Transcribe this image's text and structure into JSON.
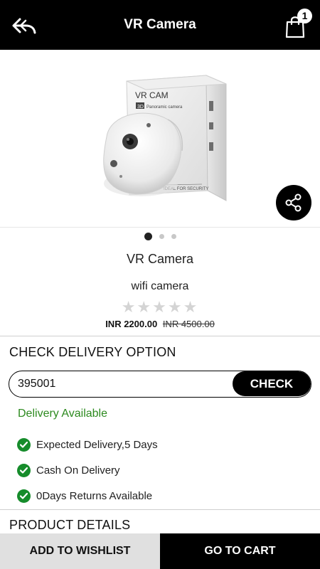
{
  "header": {
    "title": "VR Camera",
    "cart_count": "1",
    "icons": {
      "back": "back-arrow-icon",
      "cart": "shopping-bag-icon"
    }
  },
  "product_image": {
    "box_title": "VR CAM",
    "box_badge": "3D",
    "box_subtitle": "Panoramic camera",
    "box_footer": "IDEAL FOR SECURITY"
  },
  "carousel": {
    "total": 3,
    "active": 0
  },
  "product": {
    "name": "VR Camera",
    "subtitle": "wifi camera",
    "rating": 0,
    "rating_max": 5,
    "price": "INR 2200.00",
    "old_price": "INR 4500.00"
  },
  "delivery": {
    "title": "CHECK DELIVERY OPTION",
    "pincode": "395001",
    "check_label": "CHECK",
    "status": "Delivery Available",
    "features": [
      "Expected Delivery,5 Days",
      "Cash On Delivery",
      "0Days Returns Available"
    ]
  },
  "details": {
    "title": "PRODUCT DETAILS"
  },
  "actions": {
    "wishlist_label": "ADD TO WISHLIST",
    "cart_label": "GO TO CART"
  },
  "colors": {
    "header": "#000000",
    "status_green": "#2d8a1f",
    "check_icon": "#168c2b",
    "wishlist_bg": "#e0e0e0"
  }
}
